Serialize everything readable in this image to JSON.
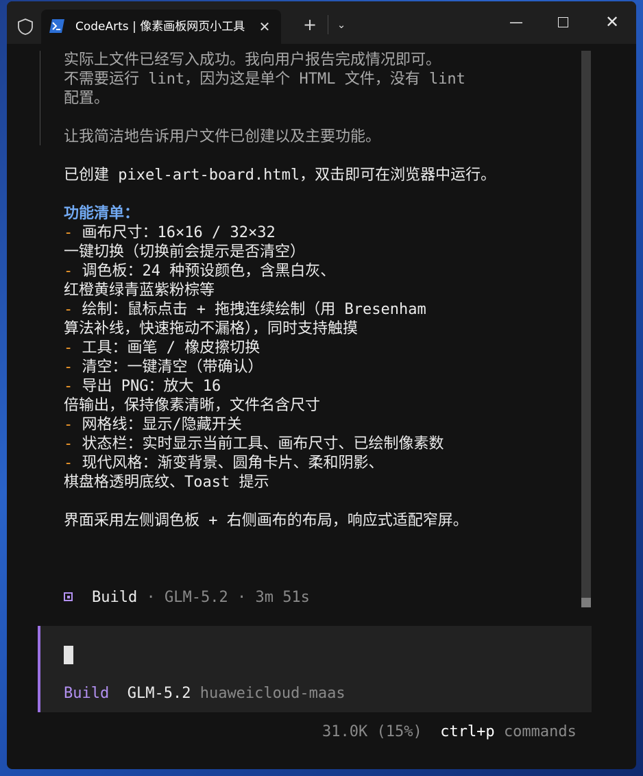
{
  "window": {
    "tab_title": "CodeArts | 像素画板网页小工具",
    "close_tab_symbol": "✕",
    "new_tab_symbol": "+",
    "dropdown_symbol": "⌄",
    "minimize_symbol": "—",
    "close_symbol": "✕"
  },
  "terminal": {
    "thinking_lines": [
      "实际上文件已经写入成功。我向用户报告完成情况即可。",
      "不需要运行 lint，因为这是单个 HTML 文件，没有 lint",
      "配置。",
      "让我简洁地告诉用户文件已创建以及主要功能。"
    ],
    "created_line": "已创建 pixel-art-board.html，双击即可在浏览器中运行。",
    "features_heading": "功能清单：",
    "dash": "-",
    "features": [
      {
        "text": "画布尺寸：16×16 / 32×32",
        "cont": "一键切换（切换前会提示是否清空）"
      },
      {
        "text": "调色板：24 种预设颜色，含黑白灰、",
        "cont": "红橙黄绿青蓝紫粉棕等"
      },
      {
        "text": "绘制：鼠标点击 + 拖拽连续绘制（用 Bresenham",
        "cont": "算法补线，快速拖动不漏格），同时支持触摸"
      },
      {
        "text": "工具：画笔 / 橡皮擦切换"
      },
      {
        "text": "清空：一键清空（带确认）"
      },
      {
        "text": "导出 PNG：放大 16",
        "cont": "倍输出，保持像素清晰，文件名含尺寸"
      },
      {
        "text": "网格线：显示/隐藏开关"
      },
      {
        "text": "状态栏：实时显示当前工具、画布尺寸、已绘制像素数"
      },
      {
        "text": "现代风格：渐变背景、圆角卡片、柔和阴影、",
        "cont": "棋盘格透明底纹、Toast 提示"
      }
    ],
    "layout_line": "界面采用左侧调色板 + 右侧画布的布局，响应式适配窄屏。",
    "status": {
      "agent": "Build",
      "sep": "·",
      "model": "GLM-5.2",
      "duration": "3m 51s"
    }
  },
  "input": {
    "agent": "Build",
    "model": "GLM-5.2",
    "provider": "huaweicloud-maas"
  },
  "footer": {
    "context": "31.0K (15%)",
    "shortcut": "ctrl+p",
    "shortcut_label": "commands"
  },
  "colors": {
    "accent_purple": "#b391f2",
    "heading_blue": "#72aaf4",
    "dash_orange": "#f39b2c",
    "terminal_bg": "#131313"
  }
}
